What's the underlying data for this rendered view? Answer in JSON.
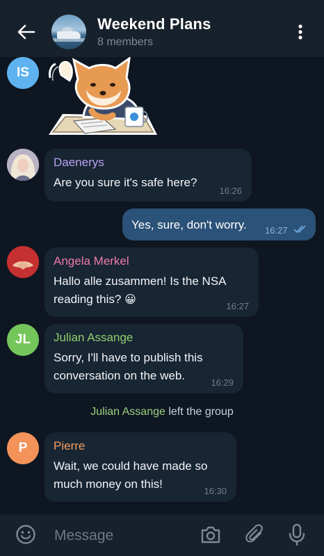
{
  "header": {
    "title": "Weekend Plans",
    "subtitle": "8 members"
  },
  "messages": {
    "is_avatar_initials": "IS",
    "daenerys": {
      "sender": "Daenerys",
      "text": "Are you sure it's safe here?",
      "time": "16:26"
    },
    "outgoing": {
      "text": "Yes, sure, don't worry.",
      "time": "16:27"
    },
    "angela": {
      "sender": "Angela Merkel",
      "line1": "Hallo alle zusammen! Is the NSA",
      "line2": "reading this?",
      "emoji": "😀",
      "time": "16:27"
    },
    "julian": {
      "initials": "JL",
      "sender": "Julian Assange",
      "line1": "Sorry, I'll have to publish this",
      "line2": "conversation on the web.",
      "time": "16:29"
    },
    "service": {
      "name": "Julian Assange",
      "text": "left the group"
    },
    "pierre": {
      "initials": "P",
      "sender": "Pierre",
      "line1": "Wait, we could have made so",
      "line2": "much money on this!",
      "time": "16:30"
    }
  },
  "composer": {
    "placeholder": "Message"
  },
  "colors": {
    "background": "#0e1621",
    "bar": "#17212b",
    "incoming_bubble": "#182533",
    "outgoing_bubble": "#2b5278",
    "daenerys_name": "#b7a2f0",
    "angela_name": "#ee7aa6",
    "julian_name": "#8fcf6c",
    "pierre_name": "#f49d5e",
    "is_avatar": "#5fb2f0",
    "jl_avatar": "#74c65a",
    "p_avatar": "#f3935a"
  }
}
